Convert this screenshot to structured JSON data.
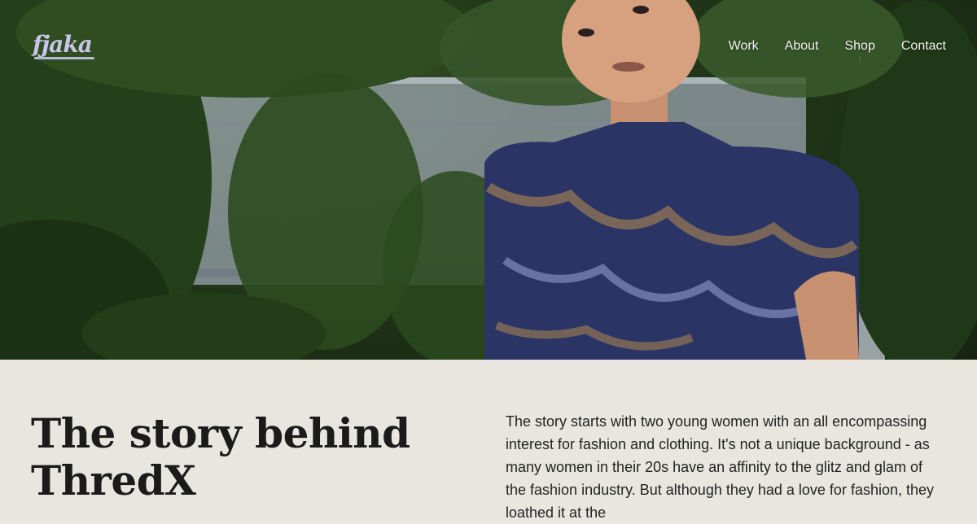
{
  "brand": {
    "logo_text": "fjaka",
    "accent": "#c9c4ea"
  },
  "nav": {
    "items": [
      {
        "label": "Work"
      },
      {
        "label": "About"
      },
      {
        "label": "Shop"
      },
      {
        "label": "Contact"
      }
    ]
  },
  "hero": {
    "image": "portrait-photo"
  },
  "article": {
    "title": "The story behind ThredX",
    "body": "The story starts with two young women with an all encompassing interest for fashion and clothing. It's not a unique background - as many women in their 20s have an affinity to the glitz and glam of the fashion industry. But although they had a love for fashion, they loathed it at the"
  },
  "colors": {
    "background": "#e8e6df",
    "text": "#1b1b1b"
  }
}
